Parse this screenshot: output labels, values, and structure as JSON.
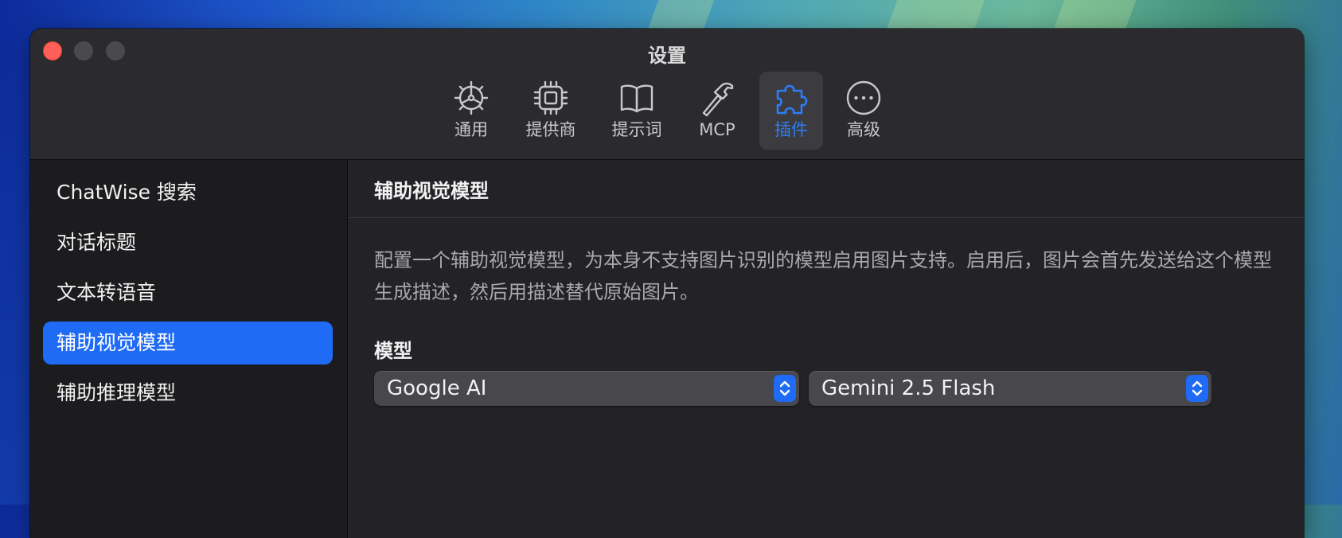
{
  "window": {
    "title": "设置"
  },
  "toolbar": {
    "tabs": [
      {
        "label": "通用",
        "icon": "gear-icon",
        "active": false
      },
      {
        "label": "提供商",
        "icon": "cpu-icon",
        "active": false
      },
      {
        "label": "提示词",
        "icon": "book-icon",
        "active": false
      },
      {
        "label": "MCP",
        "icon": "hammer-icon",
        "active": false
      },
      {
        "label": "插件",
        "icon": "puzzle-icon",
        "active": true
      },
      {
        "label": "高级",
        "icon": "more-icon",
        "active": false
      }
    ]
  },
  "sidebar": {
    "items": [
      {
        "label": "ChatWise 搜索",
        "selected": false
      },
      {
        "label": "对话标题",
        "selected": false
      },
      {
        "label": "文本转语音",
        "selected": false
      },
      {
        "label": "辅助视觉模型",
        "selected": true
      },
      {
        "label": "辅助推理模型",
        "selected": false
      }
    ]
  },
  "main": {
    "title": "辅助视觉模型",
    "description": "配置一个辅助视觉模型，为本身不支持图片识别的模型启用图片支持。启用后，图片会首先发送给这个模型生成描述，然后用描述替代原始图片。",
    "model_label": "模型",
    "provider_select": {
      "value": "Google AI"
    },
    "model_select": {
      "value": "Gemini 2.5 Flash"
    }
  },
  "colors": {
    "accent": "#1f6bf5",
    "active_tab_text": "#2f7df6",
    "close_button": "#fe5f57"
  }
}
